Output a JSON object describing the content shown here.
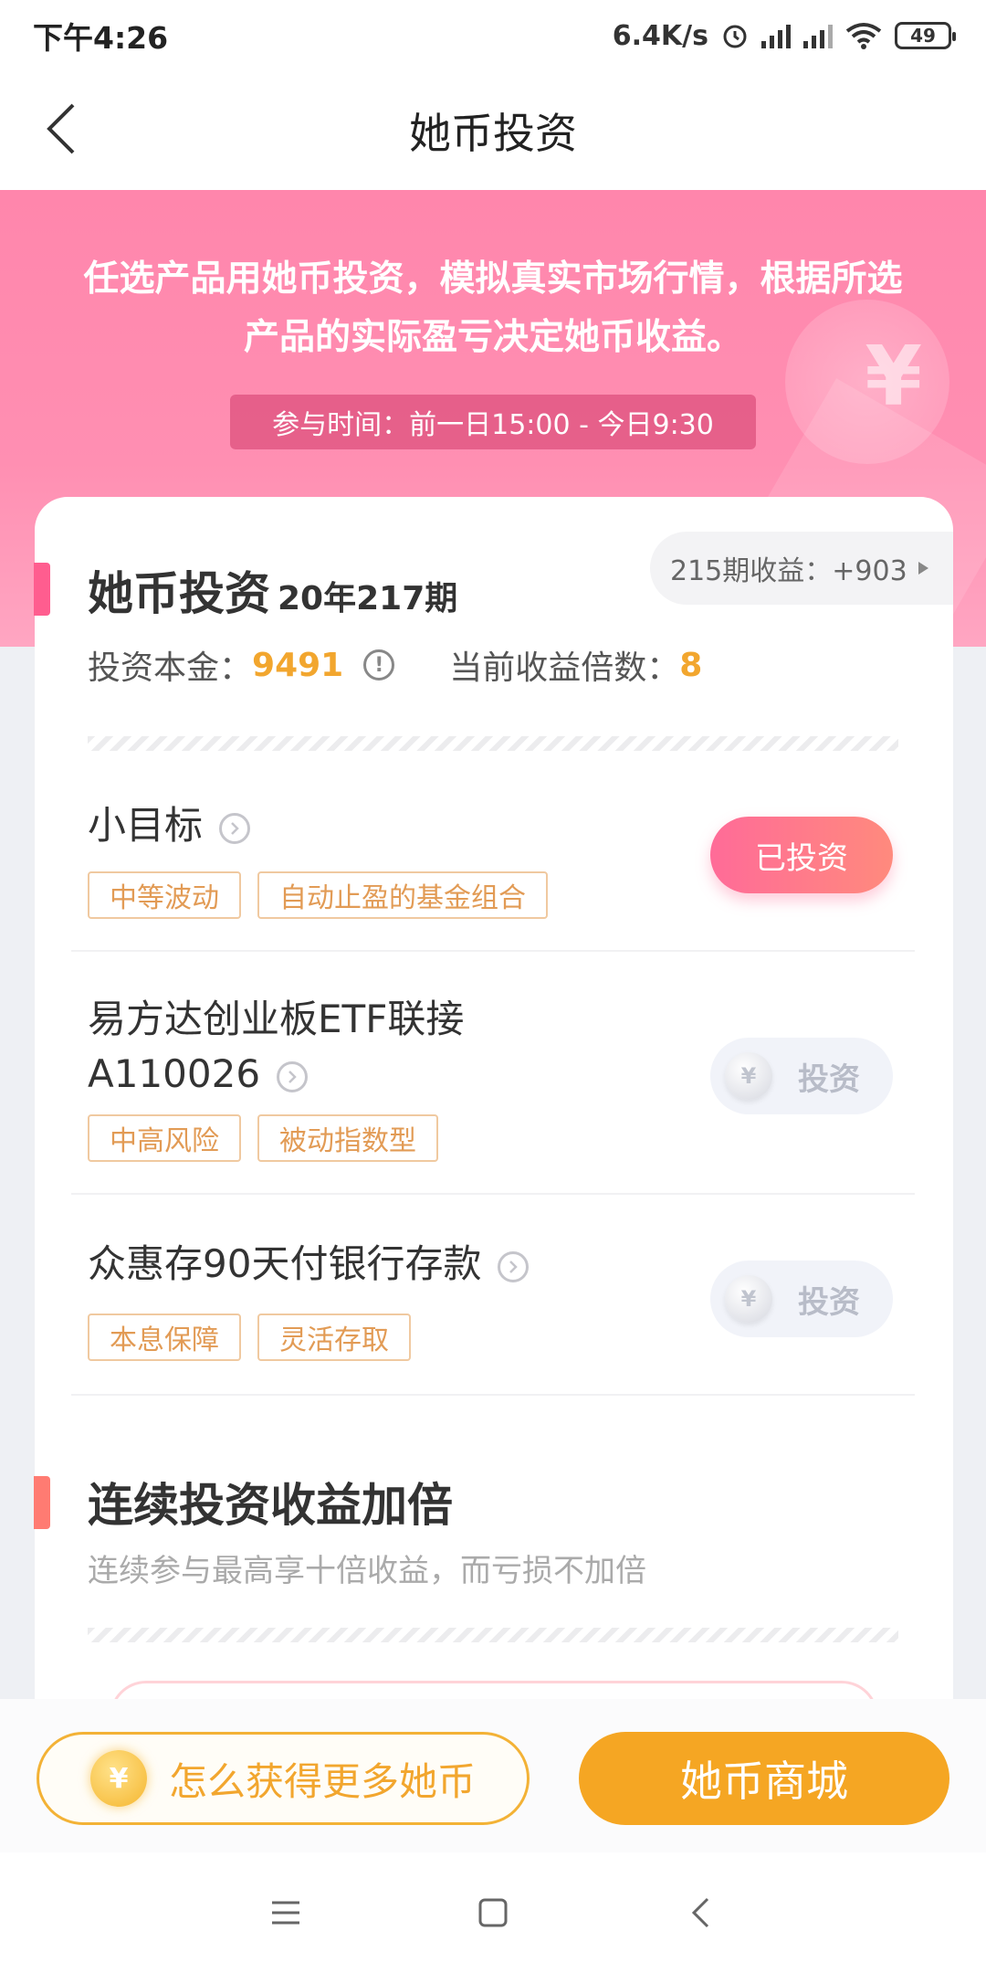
{
  "status_bar": {
    "time": "下午4:26",
    "network_speed": "6.4K/s",
    "battery": "49"
  },
  "nav": {
    "title": "她币投资"
  },
  "banner": {
    "description": "任选产品用她币投资，模拟真实市场行情，根据所选产品的实际盈亏决定她币收益。",
    "time_window": "参与时间：前一日15:00 - 今日9:30"
  },
  "investment": {
    "title": "她币投资",
    "period": "20年217期",
    "earnings_chip": "215期收益：+903",
    "principal_label": "投资本金：",
    "principal_value": "9491",
    "multiplier_label": "当前收益倍数：",
    "multiplier_value": "8"
  },
  "products": [
    {
      "name": "小目标",
      "tags": [
        "中等波动",
        "自动止盈的基金组合"
      ],
      "button": "已投资"
    },
    {
      "name_line1": "易方达创业板ETF联接",
      "name_line2": "A110026",
      "tags": [
        "中高风险",
        "被动指数型"
      ],
      "button": "投资"
    },
    {
      "name": "众惠存90天付银行存款",
      "tags": [
        "本息保障",
        "灵活存取"
      ],
      "button": "投资"
    }
  ],
  "bonus": {
    "title": "连续投资收益加倍",
    "subtitle": "连续参与最高享十倍收益，而亏损不加倍"
  },
  "actions": {
    "more_coins": "怎么获得更多她币",
    "mall": "她币商城"
  },
  "icons": {
    "coin_symbol": "¥"
  },
  "colors": {
    "banner_pink": "#ff86ac",
    "accent_orange": "#f5a623",
    "invested_pink": "#ff6b98"
  }
}
